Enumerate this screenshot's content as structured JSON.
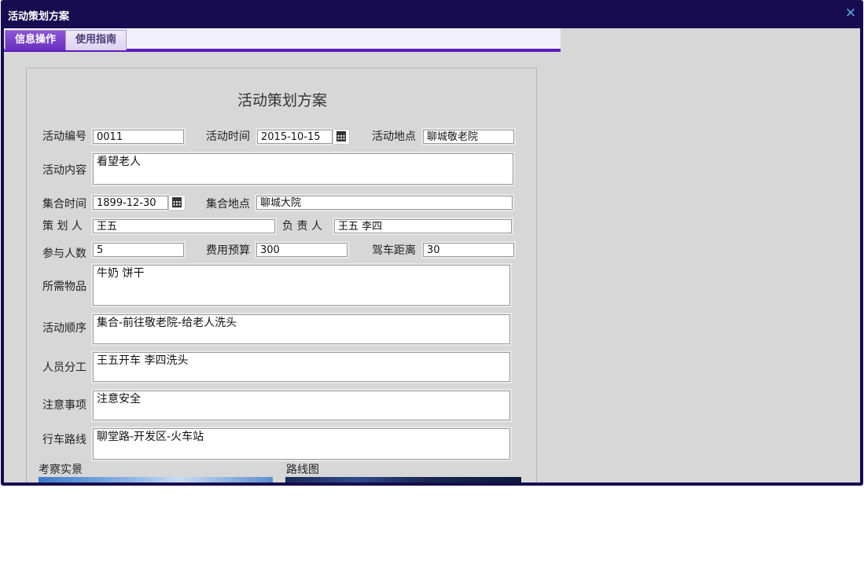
{
  "window": {
    "title": "活动策划方案",
    "close_icon": "close-icon"
  },
  "tabs": [
    {
      "label": "信息操作",
      "active": true
    },
    {
      "label": "使用指南",
      "active": false
    }
  ],
  "form": {
    "title": "活动策划方案",
    "activity_no": {
      "label": "活动编号",
      "value": "0011"
    },
    "activity_time": {
      "label": "活动时间",
      "value": "2015-10-15"
    },
    "activity_place": {
      "label": "活动地点",
      "value": "聊城敬老院"
    },
    "content": {
      "label": "活动内容",
      "value": "看望老人"
    },
    "gather_time": {
      "label": "集合时间",
      "value": "1899-12-30"
    },
    "gather_place": {
      "label": "集合地点",
      "value": "聊城大院"
    },
    "planner": {
      "label": "策 划 人",
      "value": "王五"
    },
    "owner": {
      "label": "负 责 人",
      "value": "王五 李四"
    },
    "participants": {
      "label": "参与人数",
      "value": "5"
    },
    "budget": {
      "label": "费用预算",
      "value": "300"
    },
    "distance": {
      "label": "驾车距离",
      "value": "30"
    },
    "items": {
      "label": "所需物品",
      "value": "牛奶 饼干"
    },
    "sequence": {
      "label": "活动顺序",
      "value": "集合-前往敬老院-给老人洗头"
    },
    "division": {
      "label": "人员分工",
      "value": "王五开车 李四洗头"
    },
    "notes": {
      "label": "注意事项",
      "value": "注意安全"
    },
    "route": {
      "label": "行车路线",
      "value": "聊堂路-开发区-火车站"
    },
    "photo_label": "考察实景",
    "map_label": "路线图"
  },
  "colors": {
    "title_bar": "#170c4f",
    "tab_accent": "#5a1bbd",
    "client_bg": "#d7d7d7"
  }
}
